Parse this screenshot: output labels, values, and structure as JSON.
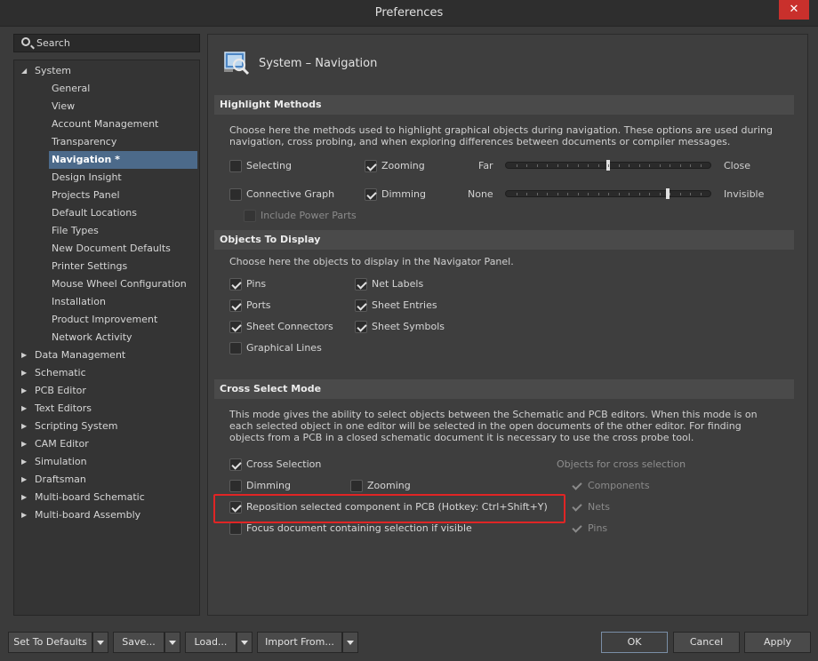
{
  "window": {
    "title": "Preferences",
    "close_glyph": "✕"
  },
  "search": {
    "placeholder": "Search"
  },
  "tree": {
    "items": [
      {
        "label": "System",
        "level": "top",
        "expanded": true
      },
      {
        "label": "General",
        "level": "child"
      },
      {
        "label": "View",
        "level": "child"
      },
      {
        "label": "Account Management",
        "level": "child"
      },
      {
        "label": "Transparency",
        "level": "child"
      },
      {
        "label": "Navigation *",
        "level": "child",
        "selected": true
      },
      {
        "label": "Design Insight",
        "level": "child"
      },
      {
        "label": "Projects Panel",
        "level": "child"
      },
      {
        "label": "Default Locations",
        "level": "child"
      },
      {
        "label": "File Types",
        "level": "child"
      },
      {
        "label": "New Document Defaults",
        "level": "child"
      },
      {
        "label": "Printer Settings",
        "level": "child"
      },
      {
        "label": "Mouse Wheel Configuration",
        "level": "child"
      },
      {
        "label": "Installation",
        "level": "child"
      },
      {
        "label": "Product Improvement",
        "level": "child"
      },
      {
        "label": "Network Activity",
        "level": "child"
      },
      {
        "label": "Data Management",
        "level": "top"
      },
      {
        "label": "Schematic",
        "level": "top"
      },
      {
        "label": "PCB Editor",
        "level": "top"
      },
      {
        "label": "Text Editors",
        "level": "top"
      },
      {
        "label": "Scripting System",
        "level": "top"
      },
      {
        "label": "CAM Editor",
        "level": "top"
      },
      {
        "label": "Simulation",
        "level": "top"
      },
      {
        "label": "Draftsman",
        "level": "top"
      },
      {
        "label": "Multi-board Schematic",
        "level": "top"
      },
      {
        "label": "Multi-board Assembly",
        "level": "top"
      }
    ]
  },
  "page": {
    "title": "System – Navigation",
    "icon": "navigation-icon"
  },
  "highlight": {
    "header": "Highlight Methods",
    "description": "Choose here the methods used to highlight graphical objects during navigation. These options are used during navigation, cross probing, and when exploring differences between documents or compiler messages.",
    "selecting": {
      "label": "Selecting",
      "checked": false
    },
    "zooming": {
      "label": "Zooming",
      "checked": true
    },
    "connective": {
      "label": "Connective Graph",
      "checked": false
    },
    "dimming": {
      "label": "Dimming",
      "checked": true
    },
    "power_parts": {
      "label": "Include Power Parts",
      "checked": false
    },
    "zoom_slider": {
      "left": "Far",
      "right": "Close",
      "level": 0.5
    },
    "dim_slider": {
      "left": "None",
      "right": "Invisible",
      "level": 0.79
    }
  },
  "objects": {
    "header": "Objects To Display",
    "description": "Choose here the objects to display in the Navigator Panel.",
    "pins": {
      "label": "Pins",
      "checked": true
    },
    "net_labels": {
      "label": "Net Labels",
      "checked": true
    },
    "ports": {
      "label": "Ports",
      "checked": true
    },
    "sheet_entries": {
      "label": "Sheet Entries",
      "checked": true
    },
    "sheet_connectors": {
      "label": "Sheet Connectors",
      "checked": true
    },
    "sheet_symbols": {
      "label": "Sheet Symbols",
      "checked": true
    },
    "graphical_lines": {
      "label": "Graphical Lines",
      "checked": false
    }
  },
  "cross": {
    "header": "Cross Select Mode",
    "description": "This mode gives the ability to select objects between the Schematic and PCB editors.  When this mode is on each selected object in one editor will be selected in the open documents of the other editor.  For finding objects from a PCB in a closed schematic document it is necessary to use the cross probe tool.",
    "cross_selection": {
      "label": "Cross Selection",
      "checked": true
    },
    "dimming": {
      "label": "Dimming",
      "checked": false
    },
    "zooming": {
      "label": "Zooming",
      "checked": false
    },
    "reposition": {
      "label": "Reposition selected component in PCB (Hotkey: Ctrl+Shift+Y)",
      "checked": true
    },
    "focus": {
      "label": "Focus document containing selection if visible",
      "checked": false
    },
    "objects_label": "Objects for cross selection",
    "components": {
      "label": "Components",
      "checked": true
    },
    "nets": {
      "label": "Nets",
      "checked": true
    },
    "pins": {
      "label": "Pins",
      "checked": true
    }
  },
  "buttons": {
    "set_defaults": "Set To Defaults",
    "save": "Save...",
    "load": "Load...",
    "import_from": "Import From...",
    "ok": "OK",
    "cancel": "Cancel",
    "apply": "Apply"
  }
}
